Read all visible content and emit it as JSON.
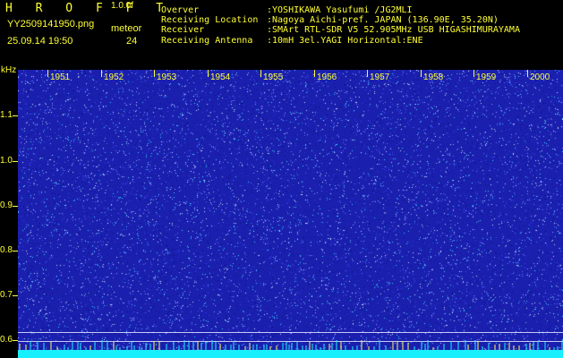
{
  "header": {
    "app_name": "H R O F F T",
    "version": "1.0.0f",
    "filename": "YY2509141950.png",
    "datetime": "25.09.14 19:50",
    "meteor_label": "meteor",
    "meteor_count": "24"
  },
  "info": [
    {
      "key": "Overver",
      "value": ":YOSHIKAWA Yasufumi /JG2MLI"
    },
    {
      "key": "Receiving Location",
      "value": ":Nagoya Aichi-pref. JAPAN (136.90E, 35.20N)"
    },
    {
      "key": "Receiver",
      "value": ":SMArt RTL-SDR V5 52.905MHz USB HIGASHIMURAYAMA"
    },
    {
      "key": "Receiving Antenna",
      "value": ":10mH 3el.YAGI Horizontal:ENE"
    }
  ],
  "y_axis": {
    "unit": "kHz",
    "ticks": [
      "1.1",
      "1.0",
      "0.9",
      "0.8",
      "0.7",
      "0.6"
    ]
  },
  "time_labels": [
    "1951",
    "1952",
    "1953",
    "1954",
    "1955",
    "1956",
    "1957",
    "1958",
    "1959",
    "2000"
  ],
  "colors": {
    "text": "#ffff33",
    "background": "#000000",
    "plot": "#1a1fae",
    "band": "#19f0ff"
  }
}
